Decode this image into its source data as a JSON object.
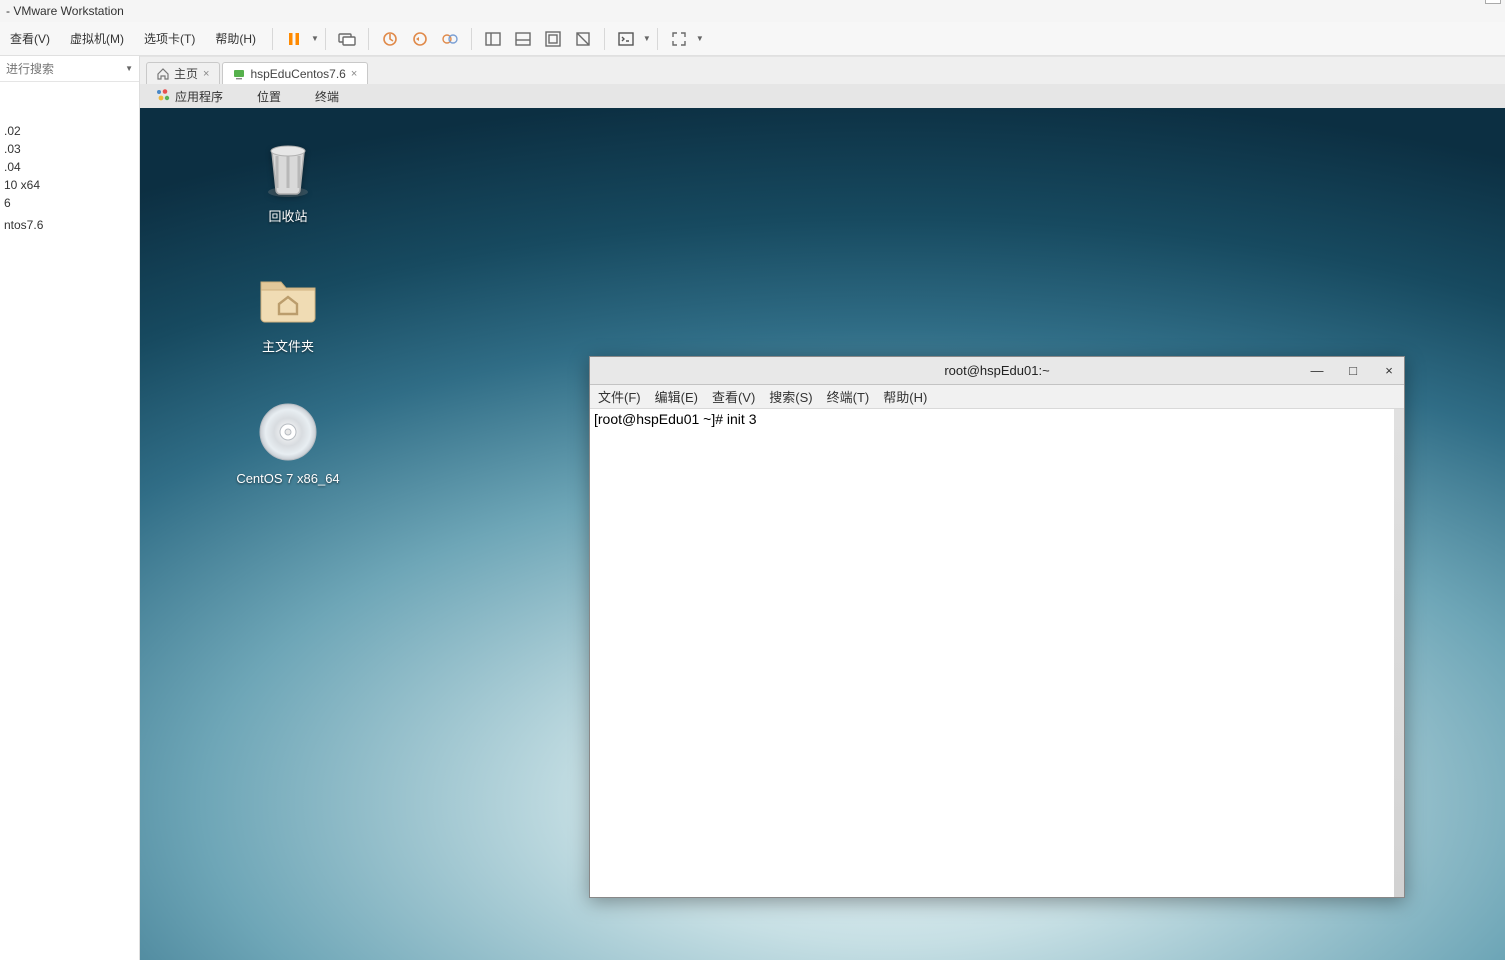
{
  "app": {
    "title": "- VMware Workstation"
  },
  "vmw_menu": {
    "view": "查看(V)",
    "vm": "虚拟机(M)",
    "tabs": "选项卡(T)",
    "help": "帮助(H)"
  },
  "sidebar": {
    "search_placeholder": "进行搜索",
    "items": [
      ".02",
      ".03",
      ".04",
      "10 x64",
      "6",
      "",
      "ntos7.6"
    ]
  },
  "tabs": [
    {
      "label": "主页",
      "home": true
    },
    {
      "label": "hspEduCentos7.6",
      "active": true
    }
  ],
  "gnome": {
    "apps": "应用程序",
    "places": "位置",
    "terminal": "终端"
  },
  "desktop_icons": {
    "trash": "回收站",
    "home": "主文件夹",
    "iso": "CentOS 7 x86_64"
  },
  "terminal": {
    "title": "root@hspEdu01:~",
    "menu": {
      "file": "文件(F)",
      "edit": "编辑(E)",
      "view": "查看(V)",
      "search": "搜索(S)",
      "terminal": "终端(T)",
      "help": "帮助(H)"
    },
    "prompt": "[root@hspEdu01 ~]# init 3"
  },
  "colors": {
    "pause_orange": "#ff8a00"
  }
}
